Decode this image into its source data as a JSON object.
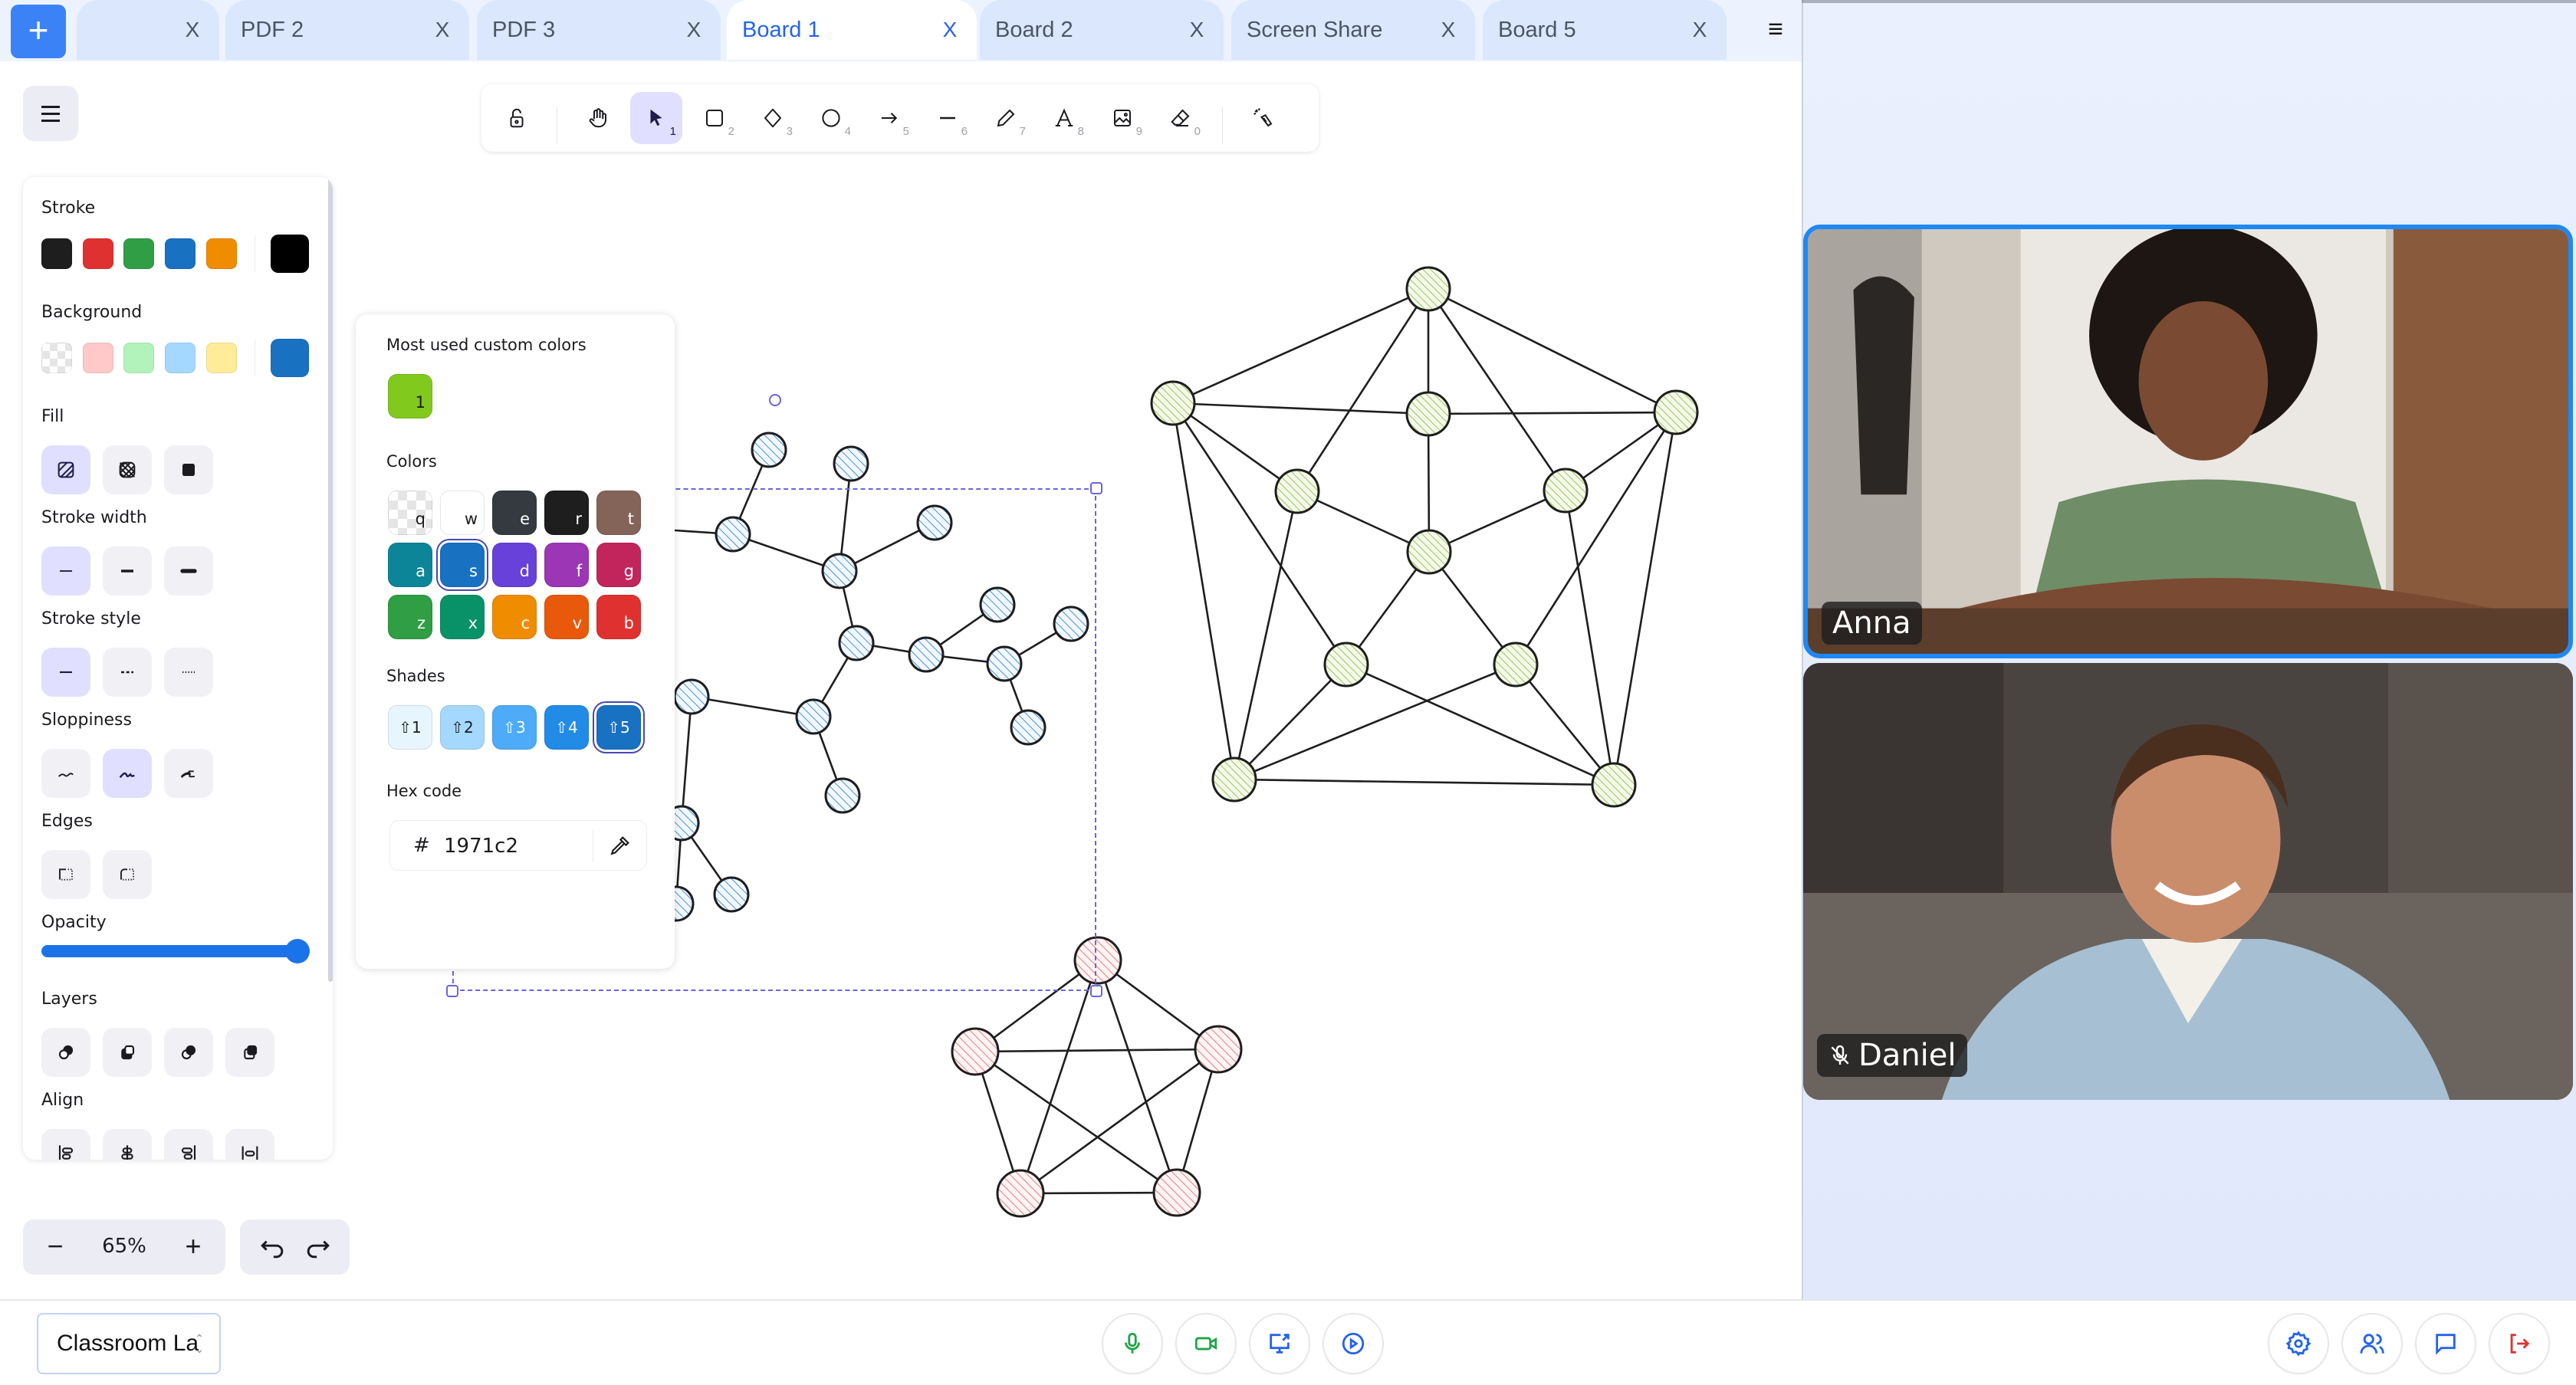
{
  "tabs": {
    "add_label": "+",
    "items": [
      {
        "label": "",
        "close": "X",
        "active": false
      },
      {
        "label": "PDF 2",
        "close": "X",
        "active": false
      },
      {
        "label": "PDF 3",
        "close": "X",
        "active": false
      },
      {
        "label": "Board 1",
        "close": "X",
        "active": true
      },
      {
        "label": "Board 2",
        "close": "X",
        "active": false
      },
      {
        "label": "Screen Share",
        "close": "X",
        "active": false
      },
      {
        "label": "Board 5",
        "close": "X",
        "active": false
      }
    ],
    "menu_icon": "hamburger-icon"
  },
  "toolbar": {
    "tools": [
      {
        "name": "lock",
        "icon": "lock-open-icon",
        "key": ""
      },
      {
        "name": "hand",
        "icon": "hand-icon",
        "key": ""
      },
      {
        "name": "selection",
        "icon": "pointer-icon",
        "key": "1",
        "active": true
      },
      {
        "name": "rectangle",
        "icon": "rectangle-icon",
        "key": "2"
      },
      {
        "name": "diamond",
        "icon": "diamond-icon",
        "key": "3"
      },
      {
        "name": "ellipse",
        "icon": "ellipse-icon",
        "key": "4"
      },
      {
        "name": "arrow",
        "icon": "arrow-icon",
        "key": "5"
      },
      {
        "name": "line",
        "icon": "line-icon",
        "key": "6"
      },
      {
        "name": "draw",
        "icon": "pencil-icon",
        "key": "7"
      },
      {
        "name": "text",
        "icon": "text-icon",
        "key": "8"
      },
      {
        "name": "image",
        "icon": "image-icon",
        "key": "9"
      },
      {
        "name": "eraser",
        "icon": "eraser-icon",
        "key": "0"
      },
      {
        "name": "laser",
        "icon": "laser-pointer-icon",
        "key": ""
      }
    ]
  },
  "properties": {
    "stroke": {
      "label": "Stroke",
      "colors": [
        "#1e1e1e",
        "#e03131",
        "#2f9e44",
        "#1971c2",
        "#f08c00"
      ],
      "current": "#000000"
    },
    "background": {
      "label": "Background",
      "colors": [
        "transparent",
        "#ffc9c9",
        "#b2f2bb",
        "#a5d8ff",
        "#ffec99"
      ],
      "current": "#1971c2"
    },
    "fill": {
      "label": "Fill",
      "options": [
        "hachure",
        "cross-hatch",
        "solid"
      ],
      "selected": "hachure"
    },
    "stroke_width": {
      "label": "Stroke width",
      "options": [
        "thin",
        "bold",
        "extra-bold"
      ],
      "selected": "thin"
    },
    "stroke_style": {
      "label": "Stroke style",
      "options": [
        "solid",
        "dashed",
        "dotted"
      ],
      "selected": "solid"
    },
    "sloppiness": {
      "label": "Sloppiness",
      "options": [
        "architect",
        "artist",
        "cartoonist"
      ],
      "selected": "artist"
    },
    "edges": {
      "label": "Edges",
      "options": [
        "sharp",
        "round"
      ]
    },
    "opacity": {
      "label": "Opacity",
      "value": 100
    },
    "layers": {
      "label": "Layers",
      "options": [
        "send-to-back",
        "send-backward",
        "bring-forward",
        "bring-to-front"
      ]
    },
    "align": {
      "label": "Align",
      "options": [
        "align-left",
        "center-horizontally",
        "align-right",
        "distribute-horizontally"
      ]
    }
  },
  "color_picker": {
    "custom_label": "Most used custom colors",
    "custom_colors": [
      {
        "color": "#82c91e",
        "key": "1"
      }
    ],
    "colors_label": "Colors",
    "colors": [
      {
        "color": "transparent",
        "key": "q"
      },
      {
        "color": "#ffffff",
        "key": "w"
      },
      {
        "color": "#343a40",
        "key": "e"
      },
      {
        "color": "#1e1e1e",
        "key": "r"
      },
      {
        "color": "#846358",
        "key": "t"
      },
      {
        "color": "#0c8599",
        "key": "a"
      },
      {
        "color": "#1971c2",
        "key": "s",
        "selected": true
      },
      {
        "color": "#6741d9",
        "key": "d"
      },
      {
        "color": "#9c36b5",
        "key": "f"
      },
      {
        "color": "#c2255c",
        "key": "g"
      },
      {
        "color": "#2f9e44",
        "key": "z"
      },
      {
        "color": "#099268",
        "key": "x"
      },
      {
        "color": "#f08c00",
        "key": "c"
      },
      {
        "color": "#e8590c",
        "key": "v"
      },
      {
        "color": "#e03131",
        "key": "b"
      }
    ],
    "shades_label": "Shades",
    "shades": [
      {
        "color": "#e7f5ff",
        "key": "⇧1"
      },
      {
        "color": "#a5d8ff",
        "key": "⇧2"
      },
      {
        "color": "#4dabf7",
        "key": "⇧3"
      },
      {
        "color": "#228be6",
        "key": "⇧4"
      },
      {
        "color": "#1971c2",
        "key": "⇧5",
        "selected": true
      }
    ],
    "hex_label": "Hex code",
    "hex_prefix": "#",
    "hex_value": "1971c2"
  },
  "zoom": {
    "minus": "−",
    "value": "65%",
    "plus": "+"
  },
  "history": {
    "undo_icon": "undo-icon",
    "redo_icon": "redo-icon"
  },
  "canvas_shapes": {
    "tree_graph": {
      "fill": "#a5d8ff",
      "stroke": "#1e1e1e",
      "fill_style": "hachure"
    },
    "dodecahedral_graph": {
      "fill": "#b2d46c",
      "stroke": "#1e1e1e",
      "fill_style": "hachure"
    },
    "pentagon_graph": {
      "fill": "#ffa8a8",
      "stroke": "#1e1e1e",
      "fill_style": "hachure"
    }
  },
  "video": {
    "participants": [
      {
        "name": "Anna",
        "speaking": true,
        "muted": false
      },
      {
        "name": "Daniel",
        "speaking": false,
        "muted": true
      }
    ]
  },
  "bottom_bar": {
    "room_select": "Classroom La",
    "media_controls": [
      {
        "name": "microphone",
        "icon": "microphone-icon",
        "color": "#22a447"
      },
      {
        "name": "camera",
        "icon": "video-camera-icon",
        "color": "#22a447"
      },
      {
        "name": "share-screen",
        "icon": "screen-share-icon",
        "color": "#2563eb"
      },
      {
        "name": "record",
        "icon": "play-circle-icon",
        "color": "#2563eb"
      }
    ],
    "right_controls": [
      {
        "name": "settings",
        "icon": "gear-icon",
        "color": "#2563eb"
      },
      {
        "name": "participants",
        "icon": "users-icon",
        "color": "#2563eb"
      },
      {
        "name": "chat",
        "icon": "chat-icon",
        "color": "#2563eb"
      },
      {
        "name": "leave",
        "icon": "leave-icon",
        "color": "#e03131"
      }
    ]
  }
}
